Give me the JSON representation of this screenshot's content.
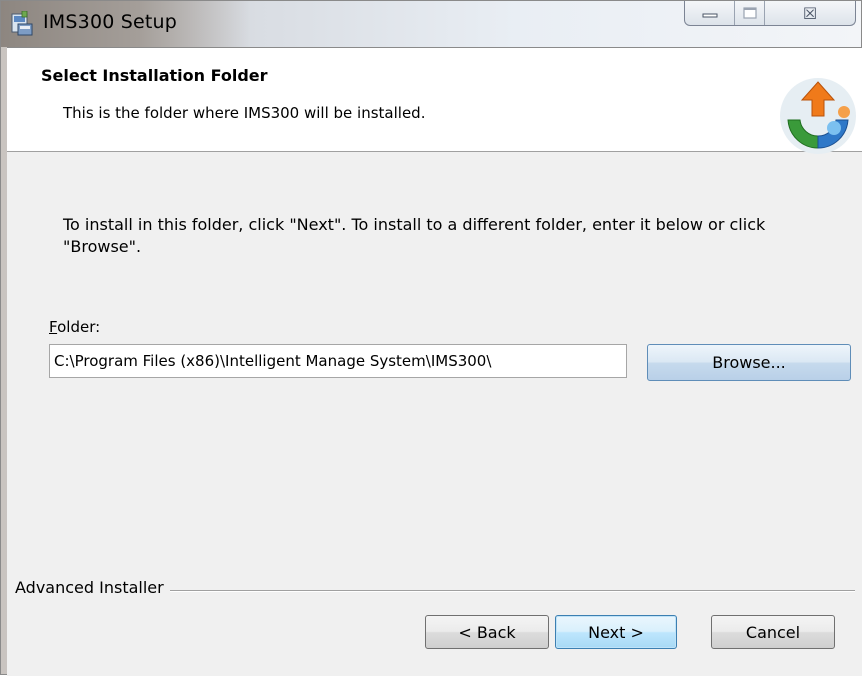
{
  "window": {
    "title": "IMS300 Setup",
    "icon": "installer-icon"
  },
  "caption": {
    "minimize_icon": "minimize-icon",
    "maximize_icon": "maximize-icon",
    "close_icon": "close-icon",
    "close_glyph": "☒"
  },
  "header": {
    "title": "Select Installation Folder",
    "subtitle": "This is the folder where IMS300 will be installed.",
    "logo": "advanced-installer-logo"
  },
  "body": {
    "description": "To install in this folder, click \"Next\". To install to a different folder, enter it below or click \"Browse\".",
    "folder_label_mnemonic": "F",
    "folder_label_rest": "older:",
    "folder_value": "C:\\Program Files (x86)\\Intelligent Manage System\\IMS300\\",
    "browse_label": "Browse..."
  },
  "footer": {
    "brand": "Advanced Installer",
    "back_label": "< Back",
    "next_label": "Next >",
    "cancel_label": "Cancel"
  },
  "colors": {
    "dialog_bg": "#f0f0f0",
    "header_bg": "#ffffff",
    "default_button_border": "#3c7fb1"
  }
}
